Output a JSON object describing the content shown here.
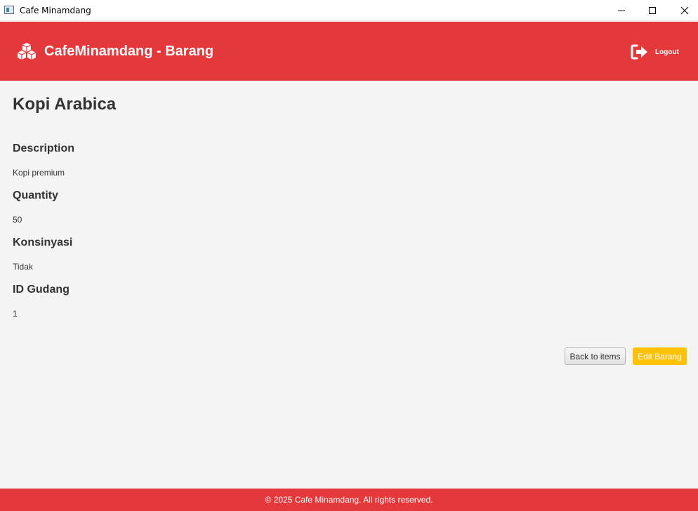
{
  "window": {
    "title": "Cafe Minamdang",
    "controls": [
      "minimize-icon",
      "maximize-icon",
      "close-icon"
    ]
  },
  "header": {
    "icon": "cubes-icon",
    "title": "CafeMinamdang - Barang",
    "logout_icon": "sign-out-icon",
    "logout_label": "Logout",
    "background_color": "#e5383b"
  },
  "item": {
    "name": "Kopi Arabica",
    "fields": [
      {
        "label": "Description",
        "value": "Kopi premium"
      },
      {
        "label": "Quantity",
        "value": "50"
      },
      {
        "label": "Konsinyasi",
        "value": "Tidak"
      },
      {
        "label": "ID Gudang",
        "value": "1"
      }
    ]
  },
  "actions": {
    "back_label": "Back to items",
    "edit_label": "Edit Barang",
    "edit_color": "#ffc107"
  },
  "footer": {
    "text": "© 2025 Cafe Minamdang. All rights reserved."
  }
}
